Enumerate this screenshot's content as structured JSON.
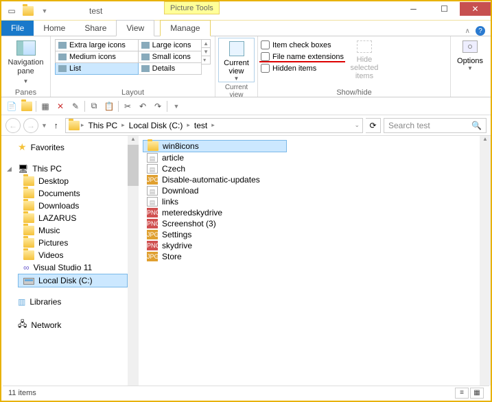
{
  "title": "test",
  "context_tab": "Picture Tools",
  "tabs": {
    "file": "File",
    "home": "Home",
    "share": "Share",
    "view": "View",
    "manage": "Manage"
  },
  "ribbon": {
    "panes": {
      "navpane": "Navigation\npane",
      "label": "Panes"
    },
    "layout": {
      "xl": "Extra large icons",
      "lg": "Large icons",
      "md": "Medium icons",
      "sm": "Small icons",
      "list": "List",
      "det": "Details",
      "label": "Layout"
    },
    "curview": {
      "btn": "Current\nview",
      "label": "Current view"
    },
    "showhide": {
      "chk1": "Item check boxes",
      "chk2": "File name extensions",
      "chk3": "Hidden items",
      "hide": "Hide selected\nitems",
      "label": "Show/hide"
    },
    "options": "Options"
  },
  "addr": {
    "thispc": "This PC",
    "c": "Local Disk (C:)",
    "test": "test",
    "search_ph": "Search test"
  },
  "tree": {
    "fav": "Favorites",
    "thispc": "This PC",
    "items": [
      "Desktop",
      "Documents",
      "Downloads",
      "LAZARUS",
      "Music",
      "Pictures",
      "Videos",
      "Visual Studio 11",
      "Local Disk (C:)"
    ],
    "libs": "Libraries",
    "net": "Network"
  },
  "files": [
    {
      "name": "win8icons",
      "type": "folder",
      "sel": true
    },
    {
      "name": "article",
      "type": "doc"
    },
    {
      "name": "Czech",
      "type": "doc"
    },
    {
      "name": "Disable-automatic-updates",
      "type": "jpg"
    },
    {
      "name": "Download",
      "type": "doc"
    },
    {
      "name": "links",
      "type": "doc"
    },
    {
      "name": "meteredskydrive",
      "type": "png"
    },
    {
      "name": "Screenshot (3)",
      "type": "png"
    },
    {
      "name": "Settings",
      "type": "jpg"
    },
    {
      "name": "skydrive",
      "type": "png"
    },
    {
      "name": "Store",
      "type": "jpg"
    }
  ],
  "status": "11 items"
}
